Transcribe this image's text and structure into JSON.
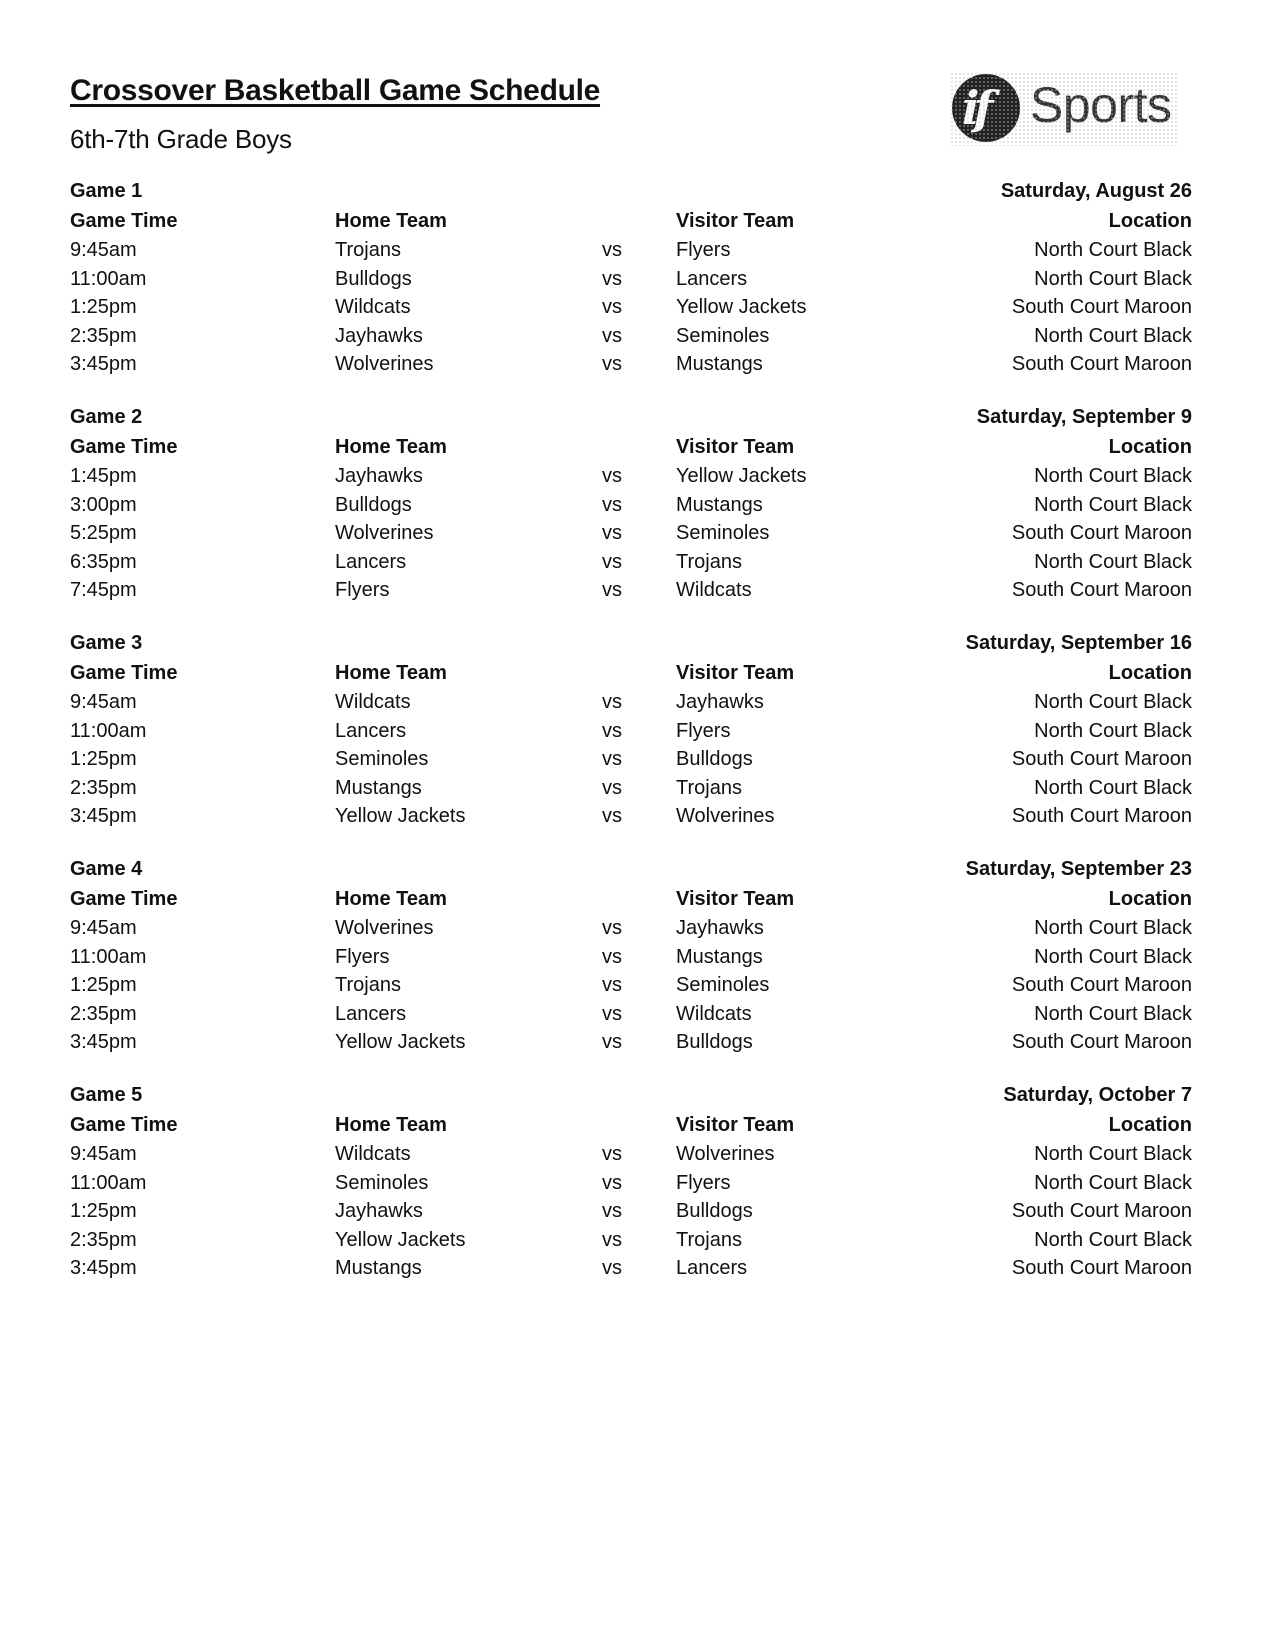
{
  "header": {
    "title": "Crossover Basketball Game Schedule",
    "subtitle": "6th-7th Grade Boys",
    "logo_text": "Sports",
    "logo_mark": "if"
  },
  "column_headers": {
    "time": "Game Time",
    "home": "Home Team",
    "visitor": "Visitor Team",
    "location": "Location"
  },
  "vs_label": "vs",
  "games": [
    {
      "label": "Game 1",
      "date": "Saturday, August 26",
      "matches": [
        {
          "time": "9:45am",
          "home": "Trojans",
          "visitor": "Flyers",
          "location": "North Court Black"
        },
        {
          "time": "11:00am",
          "home": "Bulldogs",
          "visitor": "Lancers",
          "location": "North Court Black"
        },
        {
          "time": "1:25pm",
          "home": "Wildcats",
          "visitor": "Yellow Jackets",
          "location": "South Court Maroon"
        },
        {
          "time": "2:35pm",
          "home": "Jayhawks",
          "visitor": "Seminoles",
          "location": "North Court Black"
        },
        {
          "time": "3:45pm",
          "home": "Wolverines",
          "visitor": "Mustangs",
          "location": "South Court Maroon"
        }
      ]
    },
    {
      "label": "Game 2",
      "date": "Saturday, September 9",
      "matches": [
        {
          "time": "1:45pm",
          "home": "Jayhawks",
          "visitor": "Yellow Jackets",
          "location": "North Court Black"
        },
        {
          "time": "3:00pm",
          "home": "Bulldogs",
          "visitor": "Mustangs",
          "location": "North Court Black"
        },
        {
          "time": "5:25pm",
          "home": "Wolverines",
          "visitor": "Seminoles",
          "location": "South Court Maroon"
        },
        {
          "time": "6:35pm",
          "home": "Lancers",
          "visitor": "Trojans",
          "location": "North Court Black"
        },
        {
          "time": "7:45pm",
          "home": "Flyers",
          "visitor": "Wildcats",
          "location": "South Court Maroon"
        }
      ]
    },
    {
      "label": "Game 3",
      "date": "Saturday, September 16",
      "matches": [
        {
          "time": "9:45am",
          "home": "Wildcats",
          "visitor": "Jayhawks",
          "location": "North Court Black"
        },
        {
          "time": "11:00am",
          "home": "Lancers",
          "visitor": "Flyers",
          "location": "North Court Black"
        },
        {
          "time": "1:25pm",
          "home": "Seminoles",
          "visitor": "Bulldogs",
          "location": "South Court Maroon"
        },
        {
          "time": "2:35pm",
          "home": "Mustangs",
          "visitor": "Trojans",
          "location": "North Court Black"
        },
        {
          "time": "3:45pm",
          "home": "Yellow Jackets",
          "visitor": "Wolverines",
          "location": "South Court Maroon"
        }
      ]
    },
    {
      "label": "Game 4",
      "date": "Saturday, September 23",
      "matches": [
        {
          "time": "9:45am",
          "home": "Wolverines",
          "visitor": "Jayhawks",
          "location": "North Court Black"
        },
        {
          "time": "11:00am",
          "home": "Flyers",
          "visitor": "Mustangs",
          "location": "North Court Black"
        },
        {
          "time": "1:25pm",
          "home": "Trojans",
          "visitor": "Seminoles",
          "location": "South Court Maroon"
        },
        {
          "time": "2:35pm",
          "home": "Lancers",
          "visitor": "Wildcats",
          "location": "North Court Black"
        },
        {
          "time": "3:45pm",
          "home": "Yellow Jackets",
          "visitor": "Bulldogs",
          "location": "South Court Maroon"
        }
      ]
    },
    {
      "label": "Game 5",
      "date": "Saturday, October 7",
      "matches": [
        {
          "time": "9:45am",
          "home": "Wildcats",
          "visitor": "Wolverines",
          "location": "North Court Black"
        },
        {
          "time": "11:00am",
          "home": "Seminoles",
          "visitor": "Flyers",
          "location": "North Court Black"
        },
        {
          "time": "1:25pm",
          "home": "Jayhawks",
          "visitor": "Bulldogs",
          "location": "South Court Maroon"
        },
        {
          "time": "2:35pm",
          "home": "Yellow Jackets",
          "visitor": "Trojans",
          "location": "North Court Black"
        },
        {
          "time": "3:45pm",
          "home": "Mustangs",
          "visitor": "Lancers",
          "location": "South Court Maroon"
        }
      ]
    }
  ]
}
